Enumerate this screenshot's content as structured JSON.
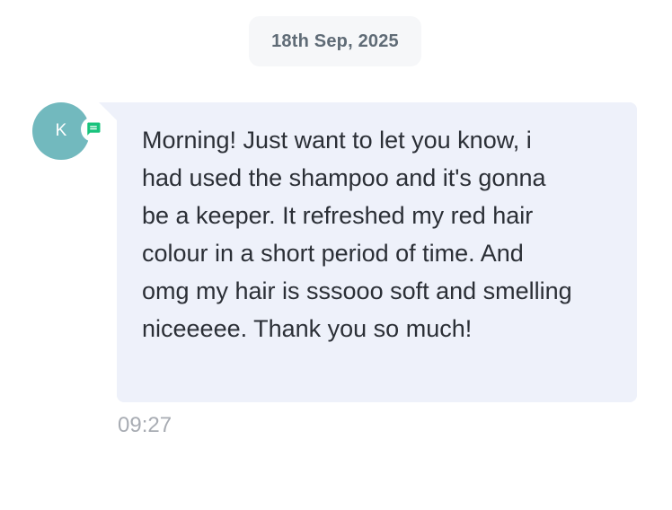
{
  "conversation": {
    "date_label": "18th Sep, 2025"
  },
  "message": {
    "avatar_initial": "K",
    "channel_icon": "chat-bubble-icon",
    "channel_color": "#19c37d",
    "text": "Morning! Just want to let you know, i had used the shampoo and it's gonna be a keeper. It refreshed my red hair colour in a short period of time. And omg my hair is sssooo soft and smelling niceeeee. Thank you so much!",
    "time": "09:27"
  },
  "colors": {
    "avatar_bg": "#72b9be",
    "bubble_bg": "#eef1fa",
    "date_pill_bg": "#f6f7f9"
  }
}
